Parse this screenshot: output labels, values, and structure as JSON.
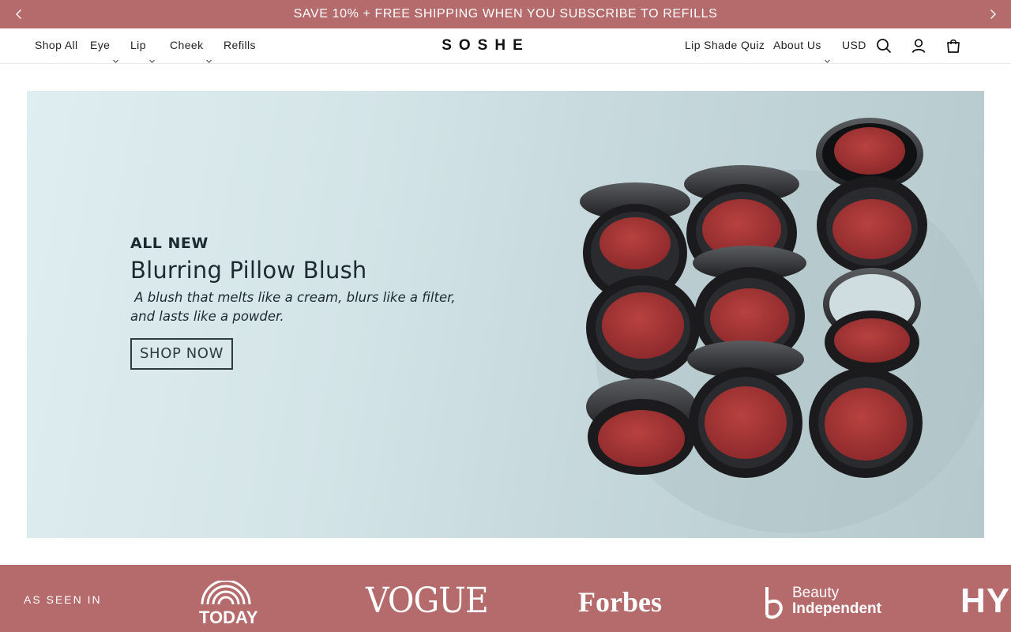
{
  "announcement": {
    "text": "SAVE 10% + FREE SHIPPING WHEN YOU SUBSCRIBE TO REFILLS"
  },
  "header": {
    "logo": "SOSHE",
    "nav_left": [
      "Shop All",
      "Eye",
      "Lip",
      "Cheek",
      "Refills"
    ],
    "nav_right": [
      "Lip Shade Quiz",
      "About Us",
      "USD"
    ]
  },
  "hero": {
    "eyebrow": "ALL NEW",
    "title": "Blurring Pillow Blush",
    "subtitle_line1": " A blush that melts like a cream, blurs like a filter,",
    "subtitle_line2": "and lasts like a powder.",
    "cta": "SHOP NOW"
  },
  "press": {
    "label": "AS SEEN IN",
    "logos": [
      "TODAY",
      "VOGUE",
      "Forbes",
      "Beauty",
      "Independent",
      "HYP"
    ]
  },
  "colors": {
    "brand": "#b56b6b",
    "blush": "#a8363a",
    "compact": "#1b1b1d"
  },
  "icons": [
    "chevron-left-icon",
    "chevron-right-icon",
    "search-icon",
    "account-icon",
    "cart-icon",
    "chevron-down-icon"
  ]
}
